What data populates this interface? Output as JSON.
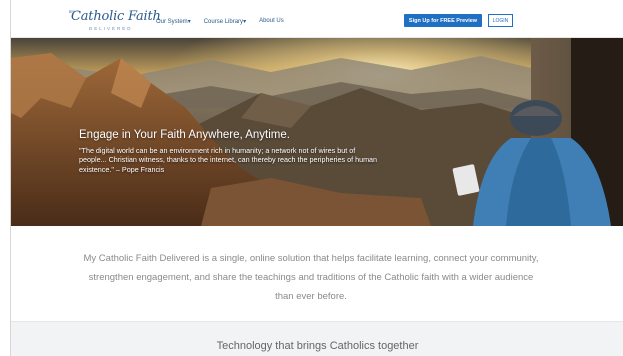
{
  "header": {
    "logo_small": "my",
    "logo_text": "Catholic Faith",
    "logo_sub": "DELIVERED",
    "nav": [
      {
        "label": "Our System"
      },
      {
        "label": "Course Library"
      },
      {
        "label": "About Us"
      }
    ],
    "signup_label": "Sign Up for FREE Preview",
    "login_label": "LOGIN"
  },
  "hero": {
    "title": "Engage in Your Faith Anywhere, Anytime.",
    "quote": "\"The digital world can be an environment rich in humanity; a network not of wires but of people... Christian witness, thanks to the internet, can thereby reach the peripheries of human existence.\" – Pope Francis"
  },
  "intro": {
    "text": "My Catholic Faith Delivered is a single, online solution that helps facilitate learning, connect your community, strengthen engagement, and share the teachings and traditions of the Catholic faith with a wider audience than ever before."
  },
  "band": {
    "heading": "Technology that brings Catholics together"
  },
  "colors": {
    "brand_blue": "#1f6fc2",
    "logo_blue": "#2b5a8c",
    "text_gray": "#8a8a8a"
  }
}
